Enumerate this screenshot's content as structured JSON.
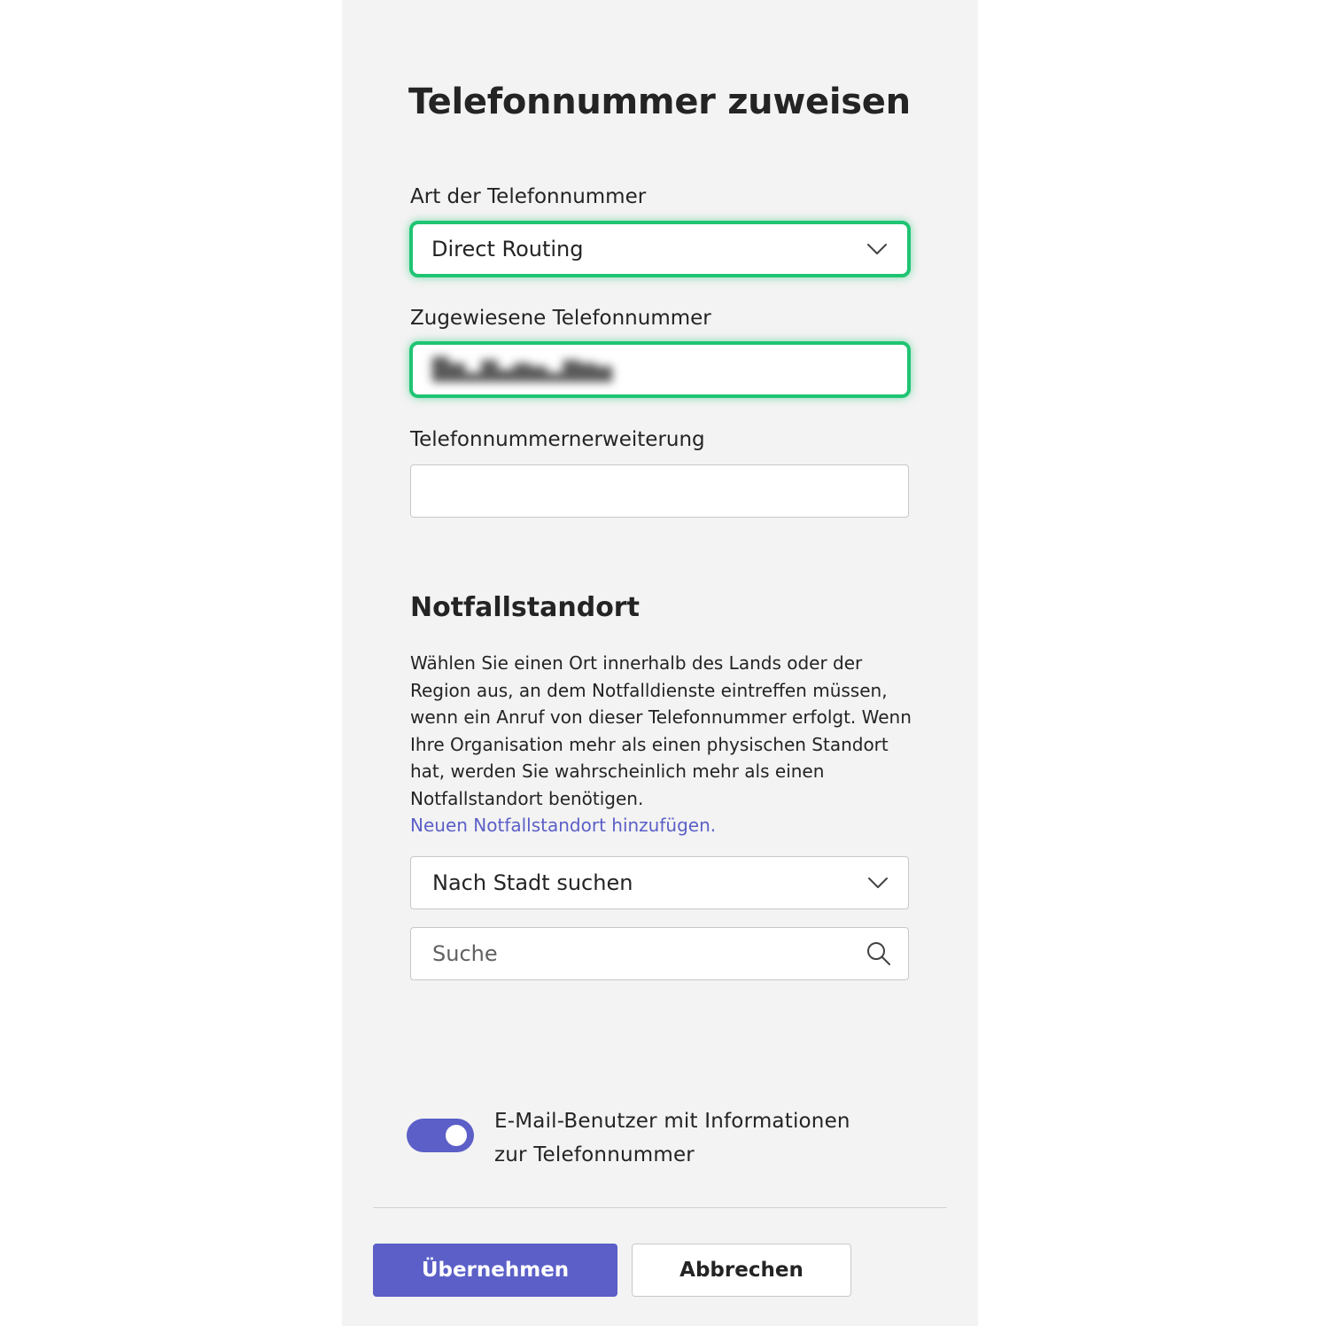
{
  "dialog": {
    "title": "Telefonnummer zuweisen"
  },
  "phone_type": {
    "label": "Art der Telefonnummer",
    "value": "Direct Routing",
    "icon": "chevron-down-icon"
  },
  "assigned_number": {
    "label": "Zugewiesene Telefonnummer",
    "value_redacted": true
  },
  "extension": {
    "label": "Telefonnummernerweiterung",
    "value": ""
  },
  "emergency": {
    "heading": "Notfallstandort",
    "description": "Wählen Sie einen Ort innerhalb des Lands oder der Region aus, an dem Notfalldienste eintreffen müssen, wenn ein Anruf von dieser Telefonnummer erfolgt. Wenn Ihre Organisation mehr als einen physischen Standort hat, werden Sie wahrscheinlich mehr als einen Notfallstandort benötigen.",
    "link_text": "Neuen Notfallstandort hinzufügen",
    "link_suffix": ".",
    "search_by": "Nach Stadt suchen",
    "search_placeholder": "Suche",
    "search_icon": "search-icon"
  },
  "email_toggle": {
    "label": "E-Mail-Benutzer mit Informationen zur Telefonnummer",
    "on": true
  },
  "actions": {
    "apply_label": "Übernehmen",
    "cancel_label": "Abbrechen"
  },
  "colors": {
    "accent": "#5b5fc7",
    "highlight": "#1fc473",
    "panel_bg": "#f3f3f3"
  }
}
